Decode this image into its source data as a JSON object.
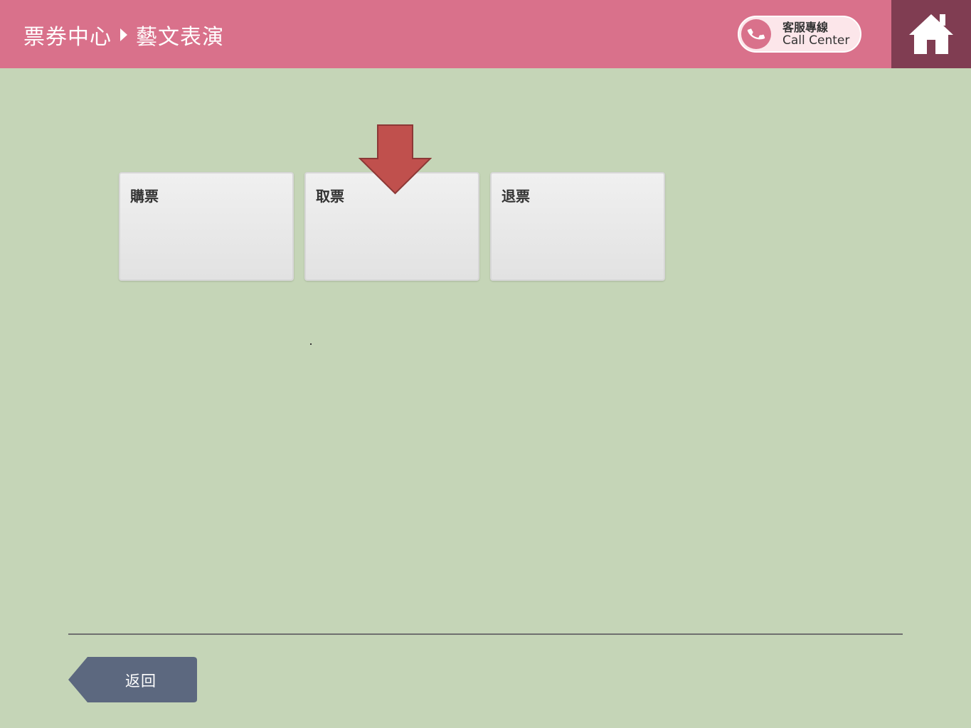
{
  "header": {
    "breadcrumb": [
      "票券中心",
      "藝文表演"
    ],
    "call_center": {
      "label_zh": "客服專線",
      "label_en": "Call Center",
      "icon": "phone-icon"
    },
    "home_icon": "home-icon"
  },
  "menu": {
    "items": [
      {
        "label": "購票"
      },
      {
        "label": "取票"
      },
      {
        "label": "退票"
      }
    ]
  },
  "pointer_icon": "down-arrow-icon",
  "footer": {
    "back_label": "返回"
  },
  "colors": {
    "header_bg": "#d9718b",
    "home_bg": "#803d52",
    "page_bg": "#c5d5b7",
    "arrow": "#c0504d",
    "back_button": "#5c687f"
  }
}
